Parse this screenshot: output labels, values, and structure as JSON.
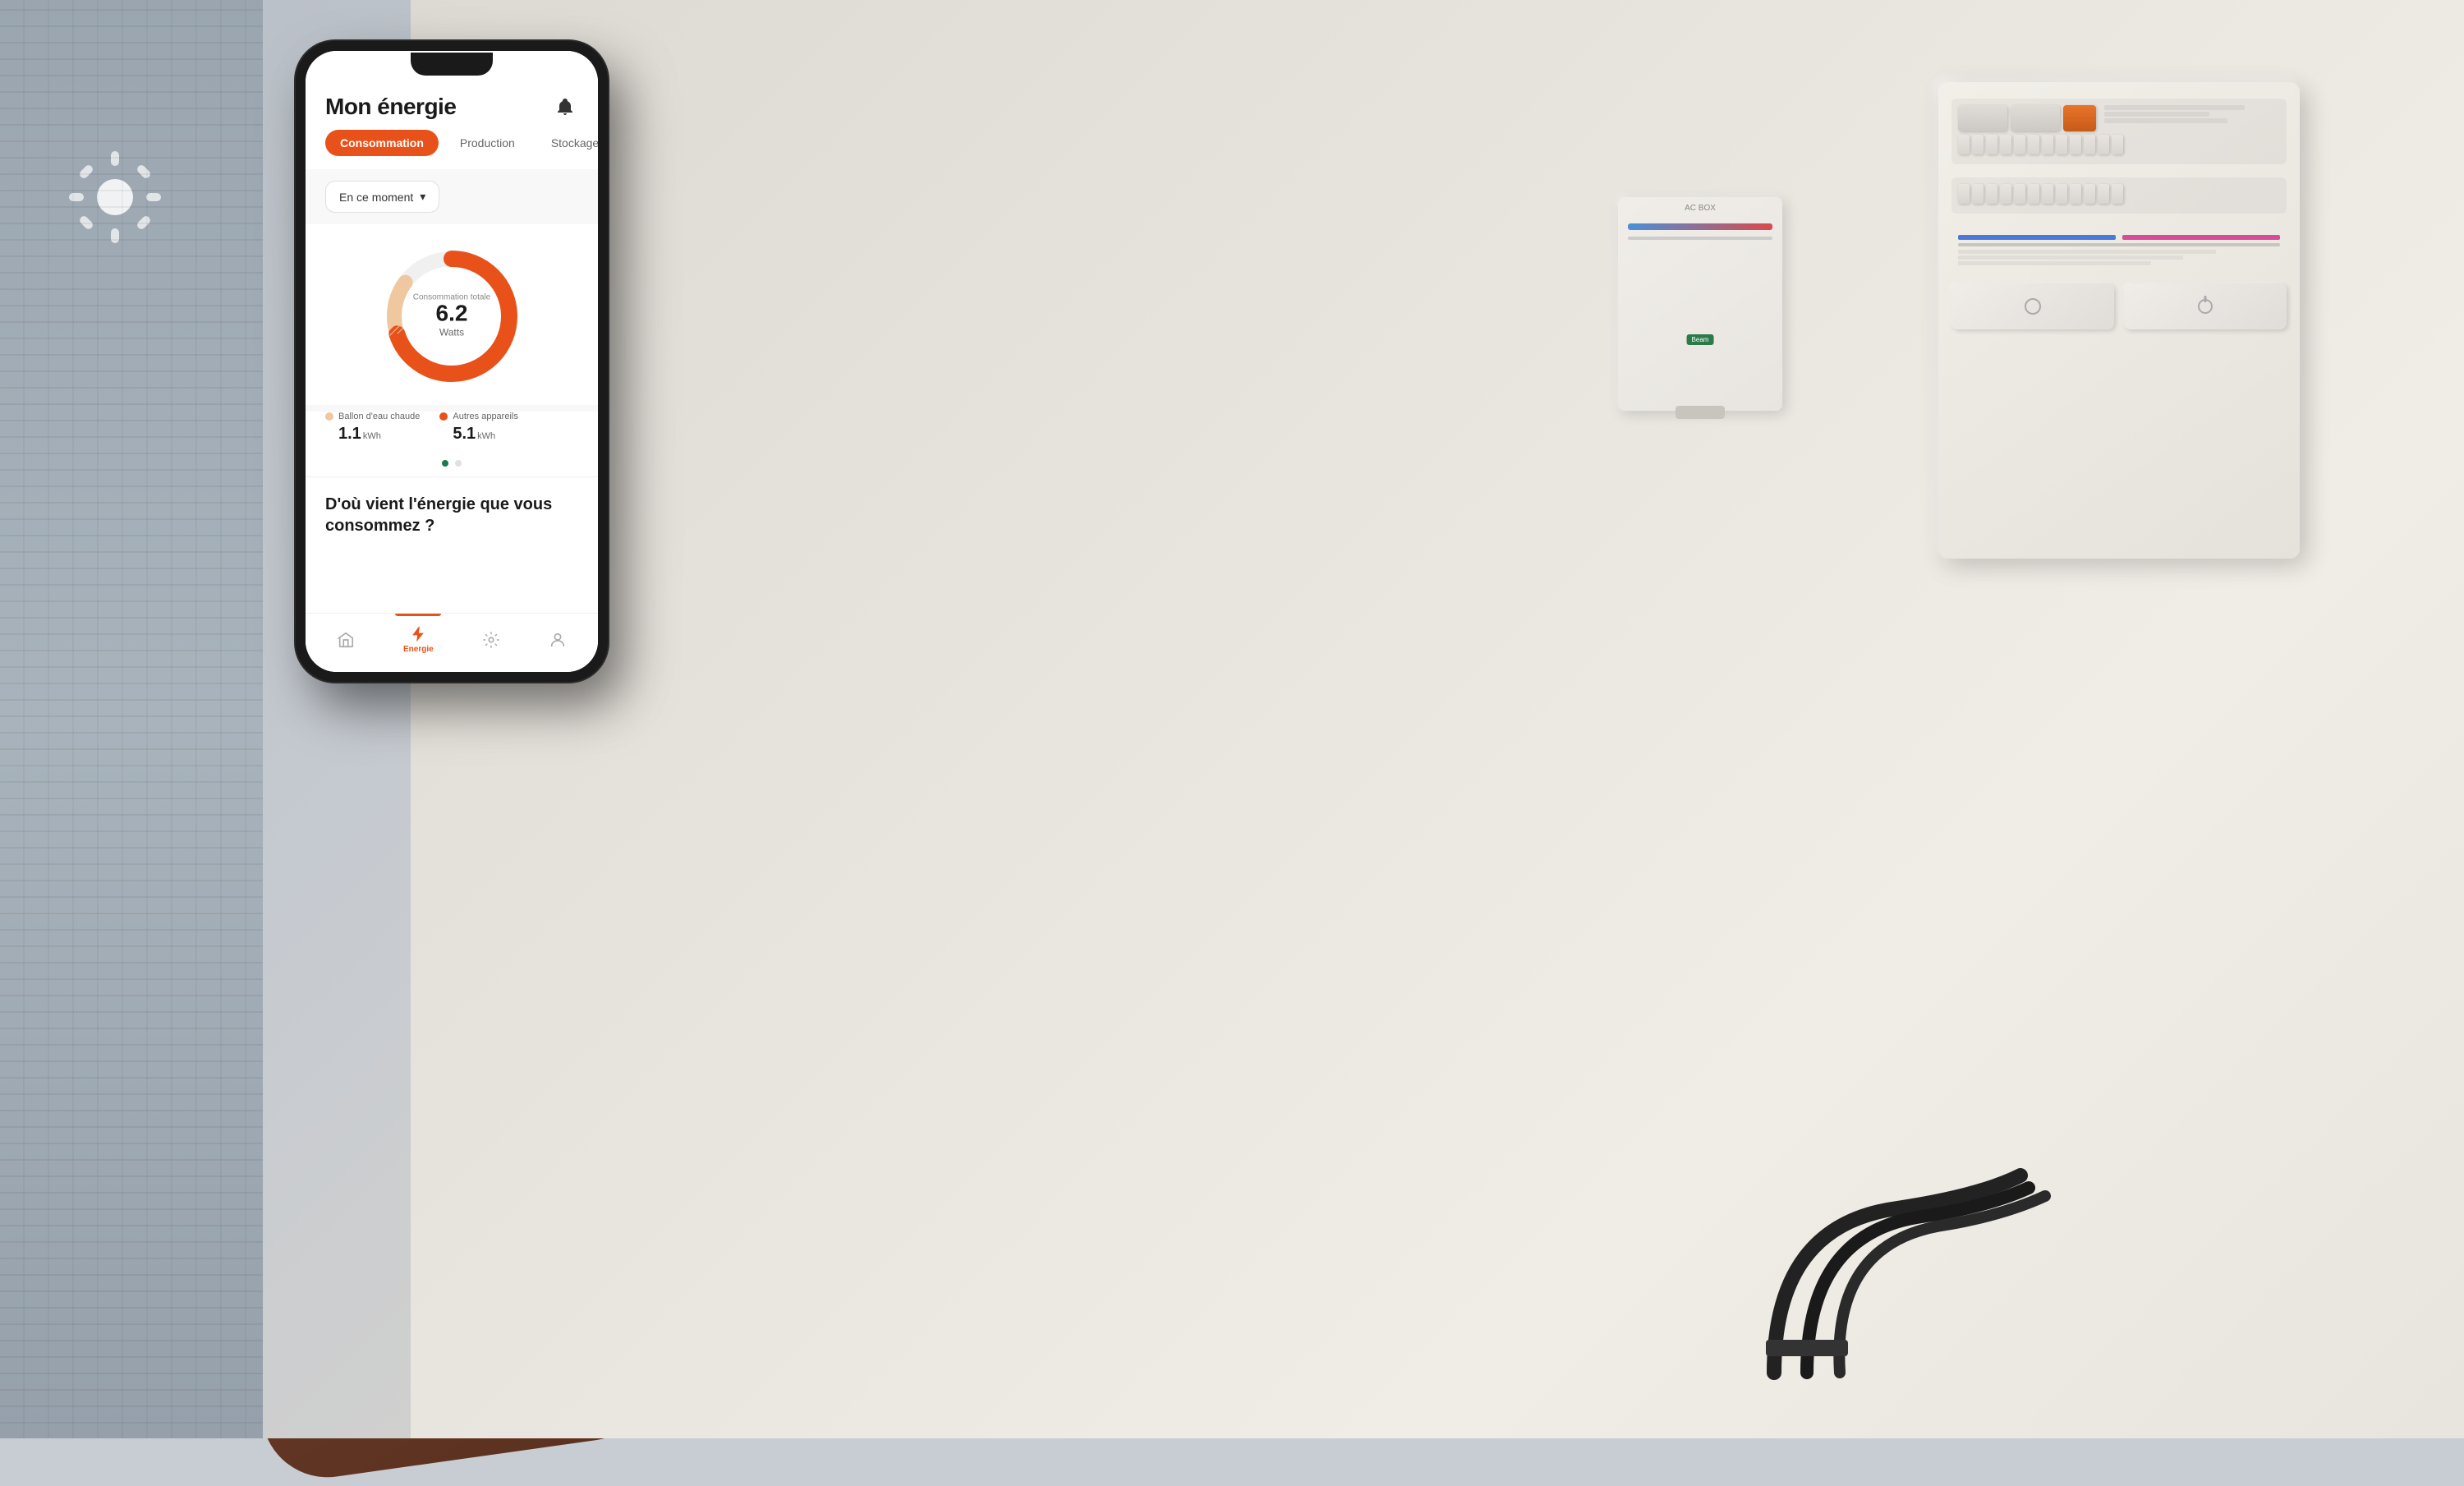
{
  "app": {
    "title": "Mon énergie",
    "bell_icon": "🔔",
    "tabs": [
      {
        "id": "consommation",
        "label": "Consommation",
        "active": true
      },
      {
        "id": "production",
        "label": "Production",
        "active": false
      },
      {
        "id": "stockage",
        "label": "Stockage",
        "active": false
      }
    ],
    "dropdown": {
      "label": "En ce moment",
      "chevron": "▾"
    },
    "chart": {
      "label": "Consommation totale",
      "value": "6.2",
      "unit": "Watts"
    },
    "legend": [
      {
        "id": "ballon",
        "label": "Ballon d'eau chaude",
        "value": "1.1",
        "unit": "kWh",
        "color": "#f5c4a8"
      },
      {
        "id": "autres",
        "label": "Autres appareils",
        "value": "5.1",
        "unit": "kWh",
        "color": "#e8521a"
      }
    ],
    "page_dots": [
      {
        "active": true
      },
      {
        "active": false
      }
    ],
    "bottom_question": "D'où vient l'énergie que vous consommez ?",
    "nav_items": [
      {
        "id": "home",
        "icon": "⌂",
        "label": "",
        "active": false
      },
      {
        "id": "energie",
        "icon": "⚡",
        "label": "Energie",
        "active": true
      },
      {
        "id": "settings",
        "icon": "◎",
        "label": "",
        "active": false
      },
      {
        "id": "profile",
        "icon": "👤",
        "label": "",
        "active": false
      }
    ]
  },
  "donut": {
    "main_color": "#e8521a",
    "secondary_color": "#f0c8a0",
    "bg_color": "#f0f0f0",
    "main_percent": 82,
    "secondary_percent": 15
  }
}
